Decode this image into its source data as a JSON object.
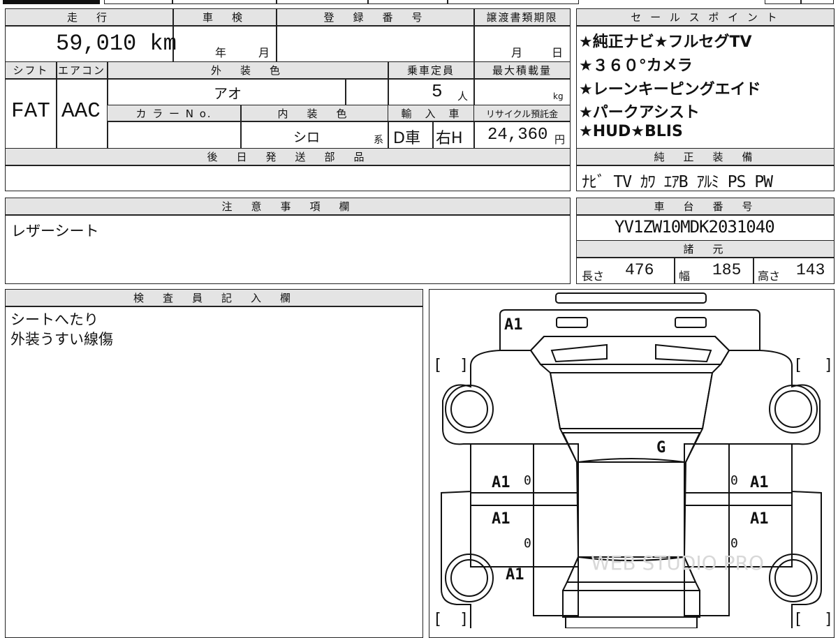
{
  "header": {
    "mileage_label": "走　行",
    "mileage_value": "59,010 km",
    "inspection_label": "車　検",
    "inspection_year": "年",
    "inspection_month": "月",
    "registration_label": "登　録　番　号",
    "transfer_label": "譲渡書類期限",
    "transfer_month": "月",
    "transfer_day": "日",
    "shift_label": "シフト",
    "shift_value": "FAT",
    "aircon_label": "エアコン",
    "aircon_value": "AAC",
    "exterior_label": "外　装　色",
    "exterior_value": "アオ",
    "capacity_label": "乗車定員",
    "capacity_value": "5",
    "capacity_unit": "人",
    "maxload_label": "最大積載量",
    "maxload_unit": "kg",
    "color_no_label": "カ ラ ー N o.",
    "interior_label": "内　装　色",
    "interior_value": "シロ",
    "interior_suffix": "系",
    "import_label": "輸　入　車",
    "import_value1": "D車",
    "import_value2": "右H",
    "recycle_label": "リサイクル預託金",
    "recycle_value": "24,360",
    "recycle_unit": "円",
    "later_parts_label": "後　日　発　送　部　品"
  },
  "sales": {
    "label": "セ ー ル ス ポ イ ン ト",
    "lines": [
      "★純正ナビ★フルセグTV",
      "★３６０°カメラ",
      "★レーンキーピングエイド",
      "★パークアシスト",
      "★HUD★BLIS"
    ],
    "equipment_label": "純　正　装　備",
    "equipment_value": "ﾅﾋﾞ TV ｶﾜ ｴｱB ｱﾙﾐ PS PW"
  },
  "notes": {
    "label": "注　意　事　項　欄",
    "text": "レザーシート"
  },
  "chassis": {
    "label": "車　台　番　号",
    "value": "YV1ZW10MDK2031040",
    "specs_label": "諸　元",
    "length_label": "長さ",
    "length_value": "476",
    "width_label": "幅",
    "width_value": "185",
    "height_label": "高さ",
    "height_value": "143"
  },
  "inspector": {
    "label": "検　査　員　記　入　欄",
    "line1": "シートへたり",
    "line2": "外装うすい線傷"
  },
  "diagram": {
    "marks": {
      "front": "A1",
      "roof": "G",
      "left_front_door": "A1",
      "left_rear_door": "A1",
      "right_front_door": "A1",
      "right_rear_door": "A1",
      "left_rear_quarter": "A1",
      "door_code": "0"
    },
    "bracket_open": "[",
    "bracket_close": "]",
    "watermark": "WEB STUDIO PRO"
  }
}
